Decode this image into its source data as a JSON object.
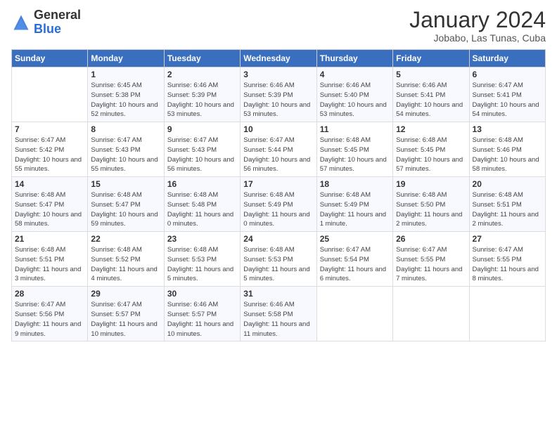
{
  "header": {
    "logo_general": "General",
    "logo_blue": "Blue",
    "month_title": "January 2024",
    "location": "Jobabo, Las Tunas, Cuba"
  },
  "weekdays": [
    "Sunday",
    "Monday",
    "Tuesday",
    "Wednesday",
    "Thursday",
    "Friday",
    "Saturday"
  ],
  "weeks": [
    [
      {
        "day": "",
        "sunrise": "",
        "sunset": "",
        "daylight": ""
      },
      {
        "day": "1",
        "sunrise": "Sunrise: 6:45 AM",
        "sunset": "Sunset: 5:38 PM",
        "daylight": "Daylight: 10 hours and 52 minutes."
      },
      {
        "day": "2",
        "sunrise": "Sunrise: 6:46 AM",
        "sunset": "Sunset: 5:39 PM",
        "daylight": "Daylight: 10 hours and 53 minutes."
      },
      {
        "day": "3",
        "sunrise": "Sunrise: 6:46 AM",
        "sunset": "Sunset: 5:39 PM",
        "daylight": "Daylight: 10 hours and 53 minutes."
      },
      {
        "day": "4",
        "sunrise": "Sunrise: 6:46 AM",
        "sunset": "Sunset: 5:40 PM",
        "daylight": "Daylight: 10 hours and 53 minutes."
      },
      {
        "day": "5",
        "sunrise": "Sunrise: 6:46 AM",
        "sunset": "Sunset: 5:41 PM",
        "daylight": "Daylight: 10 hours and 54 minutes."
      },
      {
        "day": "6",
        "sunrise": "Sunrise: 6:47 AM",
        "sunset": "Sunset: 5:41 PM",
        "daylight": "Daylight: 10 hours and 54 minutes."
      }
    ],
    [
      {
        "day": "7",
        "sunrise": "Sunrise: 6:47 AM",
        "sunset": "Sunset: 5:42 PM",
        "daylight": "Daylight: 10 hours and 55 minutes."
      },
      {
        "day": "8",
        "sunrise": "Sunrise: 6:47 AM",
        "sunset": "Sunset: 5:43 PM",
        "daylight": "Daylight: 10 hours and 55 minutes."
      },
      {
        "day": "9",
        "sunrise": "Sunrise: 6:47 AM",
        "sunset": "Sunset: 5:43 PM",
        "daylight": "Daylight: 10 hours and 56 minutes."
      },
      {
        "day": "10",
        "sunrise": "Sunrise: 6:47 AM",
        "sunset": "Sunset: 5:44 PM",
        "daylight": "Daylight: 10 hours and 56 minutes."
      },
      {
        "day": "11",
        "sunrise": "Sunrise: 6:48 AM",
        "sunset": "Sunset: 5:45 PM",
        "daylight": "Daylight: 10 hours and 57 minutes."
      },
      {
        "day": "12",
        "sunrise": "Sunrise: 6:48 AM",
        "sunset": "Sunset: 5:45 PM",
        "daylight": "Daylight: 10 hours and 57 minutes."
      },
      {
        "day": "13",
        "sunrise": "Sunrise: 6:48 AM",
        "sunset": "Sunset: 5:46 PM",
        "daylight": "Daylight: 10 hours and 58 minutes."
      }
    ],
    [
      {
        "day": "14",
        "sunrise": "Sunrise: 6:48 AM",
        "sunset": "Sunset: 5:47 PM",
        "daylight": "Daylight: 10 hours and 58 minutes."
      },
      {
        "day": "15",
        "sunrise": "Sunrise: 6:48 AM",
        "sunset": "Sunset: 5:47 PM",
        "daylight": "Daylight: 10 hours and 59 minutes."
      },
      {
        "day": "16",
        "sunrise": "Sunrise: 6:48 AM",
        "sunset": "Sunset: 5:48 PM",
        "daylight": "Daylight: 11 hours and 0 minutes."
      },
      {
        "day": "17",
        "sunrise": "Sunrise: 6:48 AM",
        "sunset": "Sunset: 5:49 PM",
        "daylight": "Daylight: 11 hours and 0 minutes."
      },
      {
        "day": "18",
        "sunrise": "Sunrise: 6:48 AM",
        "sunset": "Sunset: 5:49 PM",
        "daylight": "Daylight: 11 hours and 1 minute."
      },
      {
        "day": "19",
        "sunrise": "Sunrise: 6:48 AM",
        "sunset": "Sunset: 5:50 PM",
        "daylight": "Daylight: 11 hours and 2 minutes."
      },
      {
        "day": "20",
        "sunrise": "Sunrise: 6:48 AM",
        "sunset": "Sunset: 5:51 PM",
        "daylight": "Daylight: 11 hours and 2 minutes."
      }
    ],
    [
      {
        "day": "21",
        "sunrise": "Sunrise: 6:48 AM",
        "sunset": "Sunset: 5:51 PM",
        "daylight": "Daylight: 11 hours and 3 minutes."
      },
      {
        "day": "22",
        "sunrise": "Sunrise: 6:48 AM",
        "sunset": "Sunset: 5:52 PM",
        "daylight": "Daylight: 11 hours and 4 minutes."
      },
      {
        "day": "23",
        "sunrise": "Sunrise: 6:48 AM",
        "sunset": "Sunset: 5:53 PM",
        "daylight": "Daylight: 11 hours and 5 minutes."
      },
      {
        "day": "24",
        "sunrise": "Sunrise: 6:48 AM",
        "sunset": "Sunset: 5:53 PM",
        "daylight": "Daylight: 11 hours and 5 minutes."
      },
      {
        "day": "25",
        "sunrise": "Sunrise: 6:47 AM",
        "sunset": "Sunset: 5:54 PM",
        "daylight": "Daylight: 11 hours and 6 minutes."
      },
      {
        "day": "26",
        "sunrise": "Sunrise: 6:47 AM",
        "sunset": "Sunset: 5:55 PM",
        "daylight": "Daylight: 11 hours and 7 minutes."
      },
      {
        "day": "27",
        "sunrise": "Sunrise: 6:47 AM",
        "sunset": "Sunset: 5:55 PM",
        "daylight": "Daylight: 11 hours and 8 minutes."
      }
    ],
    [
      {
        "day": "28",
        "sunrise": "Sunrise: 6:47 AM",
        "sunset": "Sunset: 5:56 PM",
        "daylight": "Daylight: 11 hours and 9 minutes."
      },
      {
        "day": "29",
        "sunrise": "Sunrise: 6:47 AM",
        "sunset": "Sunset: 5:57 PM",
        "daylight": "Daylight: 11 hours and 10 minutes."
      },
      {
        "day": "30",
        "sunrise": "Sunrise: 6:46 AM",
        "sunset": "Sunset: 5:57 PM",
        "daylight": "Daylight: 11 hours and 10 minutes."
      },
      {
        "day": "31",
        "sunrise": "Sunrise: 6:46 AM",
        "sunset": "Sunset: 5:58 PM",
        "daylight": "Daylight: 11 hours and 11 minutes."
      },
      {
        "day": "",
        "sunrise": "",
        "sunset": "",
        "daylight": ""
      },
      {
        "day": "",
        "sunrise": "",
        "sunset": "",
        "daylight": ""
      },
      {
        "day": "",
        "sunrise": "",
        "sunset": "",
        "daylight": ""
      }
    ]
  ]
}
